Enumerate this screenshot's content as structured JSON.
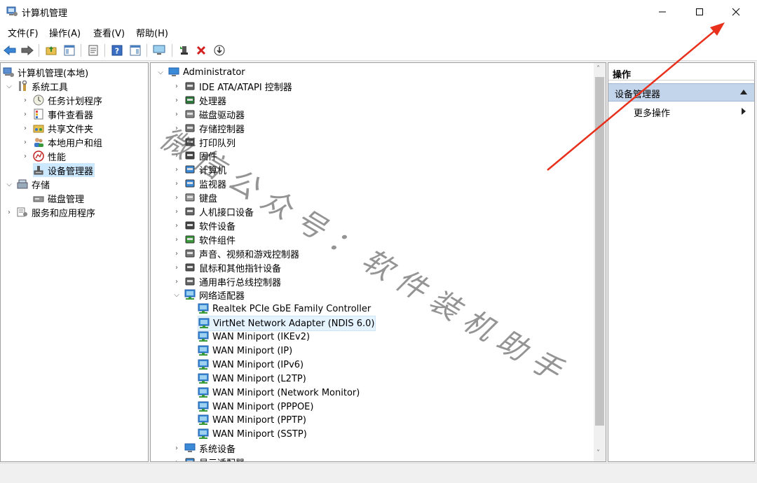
{
  "window": {
    "title": "计算机管理"
  },
  "menu": [
    "文件(F)",
    "操作(A)",
    "查看(V)",
    "帮助(H)"
  ],
  "left_tree": {
    "root": "计算机管理(本地)",
    "system_tools": "系统工具",
    "system_items": [
      "任务计划程序",
      "事件查看器",
      "共享文件夹",
      "本地用户和组",
      "性能",
      "设备管理器"
    ],
    "storage": "存储",
    "storage_items": [
      "磁盘管理"
    ],
    "services": "服务和应用程序"
  },
  "device_tree": {
    "root": "Administrator",
    "categories_before": [
      "IDE ATA/ATAPI 控制器",
      "处理器",
      "磁盘驱动器",
      "存储控制器",
      "打印队列",
      "固件",
      "计算机",
      "监视器",
      "键盘",
      "人机接口设备",
      "软件设备",
      "软件组件",
      "声音、视频和游戏控制器",
      "鼠标和其他指针设备",
      "通用串行总线控制器"
    ],
    "network_category": "网络适配器",
    "network_adapters": [
      "Realtek PCIe GbE Family Controller",
      "VirtNet Network Adapter (NDIS 6.0)",
      "WAN Miniport (IKEv2)",
      "WAN Miniport (IP)",
      "WAN Miniport (IPv6)",
      "WAN Miniport (L2TP)",
      "WAN Miniport (Network Monitor)",
      "WAN Miniport (PPPOE)",
      "WAN Miniport (PPTP)",
      "WAN Miniport (SSTP)"
    ],
    "categories_after": [
      "系统设备",
      "显示适配器"
    ]
  },
  "actions": {
    "header": "操作",
    "section": "设备管理器",
    "more": "更多操作"
  },
  "watermark": "微信公众号：软件装机助手",
  "colors": {
    "selection": "#cce8ff",
    "arrow": "#e8301c",
    "section": "#c3d5ea"
  }
}
